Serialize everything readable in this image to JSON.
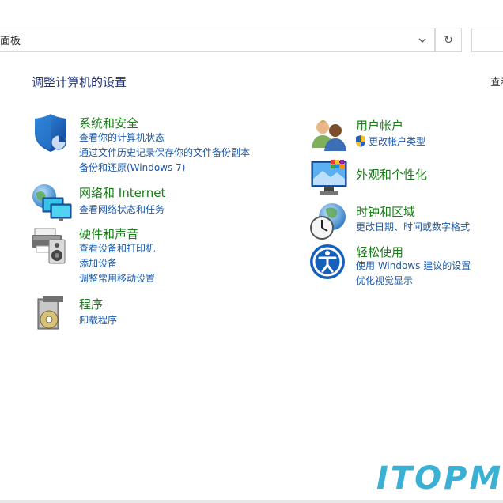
{
  "address_bar": {
    "path_text": "面板",
    "refresh_glyph": "↻"
  },
  "page_title": "调整计算机的设置",
  "view_by": "查看",
  "categories": {
    "system_security": {
      "title": "系统和安全",
      "icon": "shield-icon",
      "links": [
        "查看你的计算机状态",
        "通过文件历史记录保存你的文件备份副本",
        "备份和还原(Windows 7)"
      ]
    },
    "network": {
      "title": "网络和 Internet",
      "icon": "network-globe-icon",
      "links": [
        "查看网络状态和任务"
      ]
    },
    "hardware": {
      "title": "硬件和声音",
      "icon": "printer-speaker-icon",
      "links": [
        "查看设备和打印机",
        "添加设备",
        "调整常用移动设置"
      ]
    },
    "programs": {
      "title": "程序",
      "icon": "programs-disc-icon",
      "links": [
        "卸载程序"
      ]
    },
    "user_accounts": {
      "title": "用户帐户",
      "icon": "users-icon",
      "links": [
        "更改帐户类型"
      ]
    },
    "appearance": {
      "title": "外观和个性化",
      "icon": "monitor-palette-icon",
      "links": []
    },
    "clock_region": {
      "title": "时钟和区域",
      "icon": "clock-globe-icon",
      "links": [
        "更改日期、时间或数字格式"
      ]
    },
    "ease_of_access": {
      "title": "轻松使用",
      "icon": "ease-of-access-icon",
      "links": [
        "使用 Windows 建议的设置",
        "优化视觉显示"
      ]
    }
  },
  "watermark": "ITOPM",
  "colors": {
    "title_green": "#1a7d1a",
    "link_blue": "#1d59a8",
    "heading_blue": "#1e3287",
    "watermark_blue": "#3ab0d4"
  }
}
